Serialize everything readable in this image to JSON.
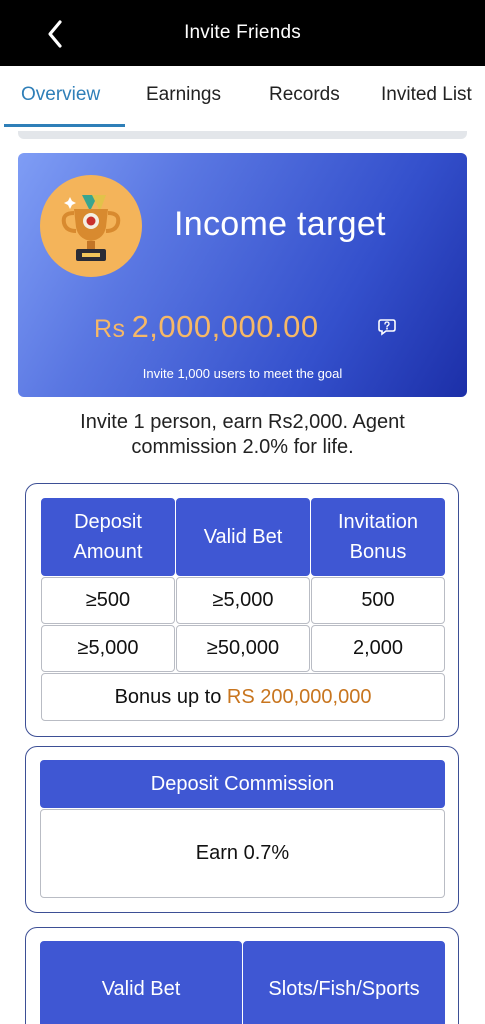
{
  "header": {
    "title": "Invite Friends",
    "back_icon": "chevron-left-icon"
  },
  "tabs": [
    {
      "label": "Overview",
      "active": true
    },
    {
      "label": "Earnings",
      "active": false
    },
    {
      "label": "Records",
      "active": false
    },
    {
      "label": "Invited List",
      "active": false
    }
  ],
  "banner": {
    "title": "Income target",
    "currency": "Rs",
    "amount": "2,000,000.00",
    "subtitle": "Invite 1,000 users to meet the goal",
    "icon": "trophy-icon",
    "help_icon": "help-chat-icon"
  },
  "invite_text": "Invite 1 person, earn Rs2,000. Agent commission 2.0% for life.",
  "bonus_table": {
    "headers": [
      "Deposit Amount",
      "Valid Bet",
      "Invitation Bonus"
    ],
    "rows": [
      [
        "≥500",
        "≥5,000",
        "500"
      ],
      [
        "≥5,000",
        "≥50,000",
        "2,000"
      ]
    ],
    "footer_label": "Bonus up to",
    "footer_value": "RS 200,000,000"
  },
  "deposit_commission": {
    "header": "Deposit Commission",
    "value": "Earn 0.7%"
  },
  "bet_table": {
    "headers": [
      "Valid Bet",
      "Slots/Fish/Sports"
    ]
  },
  "colors": {
    "accent_tab": "#2f7fb8",
    "table_header": "#3f57d3",
    "highlight": "#c8751e",
    "amount_gold": "#f6b867"
  }
}
